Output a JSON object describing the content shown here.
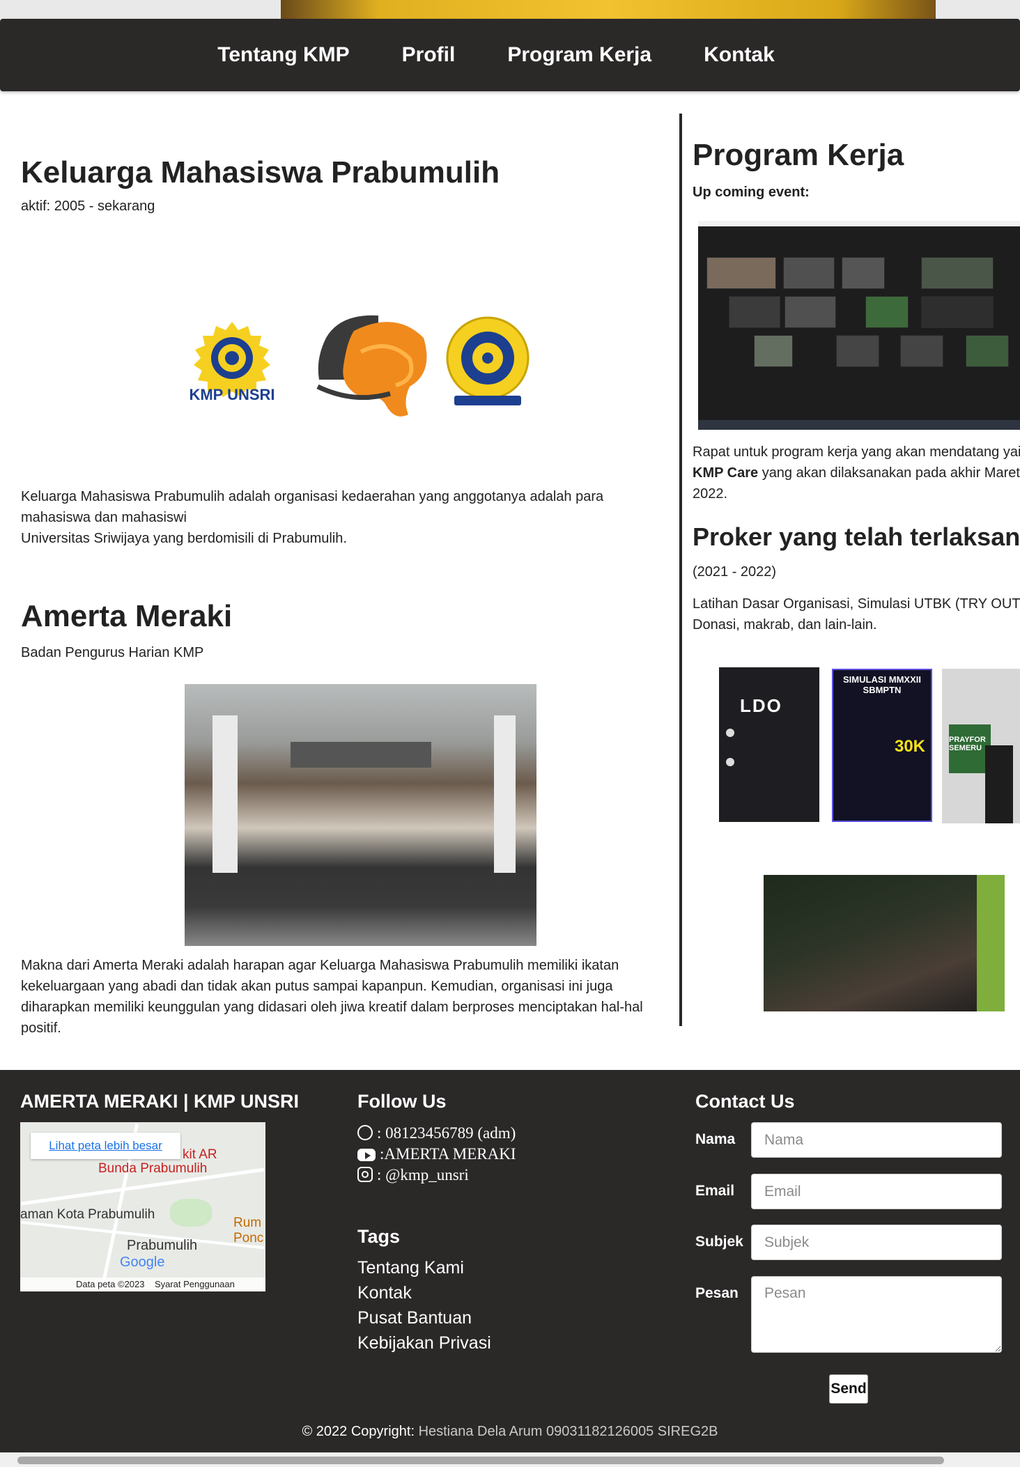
{
  "nav": {
    "items": [
      "Tentang KMP",
      "Profil",
      "Program Kerja",
      "Kontak"
    ]
  },
  "about": {
    "title": "Keluarga Mahasiswa Prabumulih",
    "active": "aktif: 2005 - sekarang",
    "logos": {
      "kmp_text": "KMP UNSRI"
    },
    "description_line1": "Keluarga Mahasiswa Prabumulih adalah organisasi kedaerahan yang anggotanya adalah para mahasiswa dan mahasiswi",
    "description_line2": "Universitas Sriwijaya yang berdomisili di Prabumulih."
  },
  "cabinet": {
    "title": "Amerta Meraki",
    "subtitle": "Badan Pengurus Harian KMP",
    "meaning": "Makna dari Amerta Meraki adalah harapan agar Keluarga Mahasiswa Prabumulih memiliki ikatan kekeluargaan yang abadi dan tidak akan putus sampai kapanpun. Kemudian, organisasi ini juga diharapkan memiliki keunggulan yang didasari oleh jiwa kreatif dalam berproses menciptakan hal-hal positif."
  },
  "program": {
    "title": "Program Kerja",
    "upcoming_label": "Up coming event:",
    "rapat_text_pre": "Rapat untuk program kerja yang akan mendatang yaitu",
    "rapat_bold": "KMP Care",
    "rapat_text_post": "yang akan dilaksanakan pada akhir Maret 2022.",
    "done_title": "Proker yang telah terlaksana",
    "done_years": "(2021 - 2022)",
    "done_list": "Latihan Dasar Organisasi, Simulasi UTBK (TRY OUT), Donasi, makrab, dan lain-lain.",
    "posters": {
      "ldo": "LDO",
      "simulasi": "SIMULASI MMXXII SBMPTN",
      "simulasi_price": "30K",
      "pray": "PRAYFOR SEMERU"
    }
  },
  "footer": {
    "brand": "AMERTA MERAKI | KMP UNSRI",
    "map": {
      "link": "Lihat peta lebih besar",
      "place1": "Bunda Prabumulih",
      "place2": "aman Kota Prabumulih",
      "place3": "Prabumulih",
      "place4": "kit AR",
      "place5": "Rum",
      "place6": "Ponc",
      "google": "Google",
      "attribution": "Data peta ©2023",
      "terms": "Syarat Penggunaan"
    },
    "follow_title": "Follow Us",
    "whatsapp": ": 08123456789 (adm)",
    "youtube": ":AMERTA MERAKI",
    "instagram": ": @kmp_unsri",
    "tags_title": "Tags",
    "tags": [
      "Tentang Kami",
      "Kontak",
      "Pusat Bantuan",
      "Kebijakan Privasi"
    ],
    "contact_title": "Contact Us",
    "form": {
      "name_label": "Nama",
      "name_placeholder": "Nama",
      "email_label": "Email",
      "email_placeholder": "Email",
      "subject_label": "Subjek",
      "subject_placeholder": "Subjek",
      "message_label": "Pesan",
      "message_placeholder": "Pesan",
      "send": "Send"
    },
    "copyright_pre": "© 2022 Copyright:",
    "copyright_name": "Hestiana Dela Arum 09031182126005 SIREG2B"
  },
  "colors": {
    "nav_bg": "#2b2828",
    "footer_bg": "#2b2828",
    "accent_yellow": "#f2c230"
  }
}
